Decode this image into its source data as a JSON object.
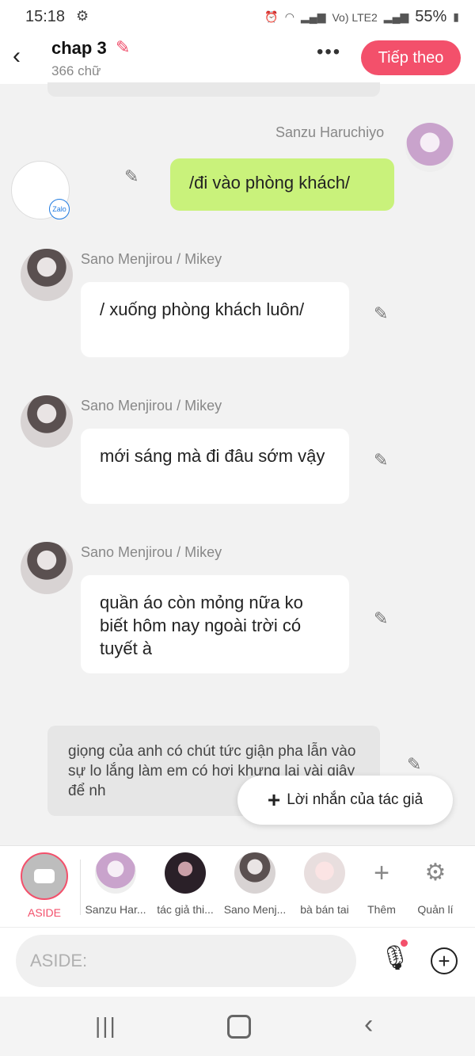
{
  "status": {
    "time": "15:18",
    "network": "Vo) LTE2",
    "battery": "55%"
  },
  "header": {
    "title": "chap 3",
    "word_count": "366 chữ",
    "next_label": "Tiếp theo",
    "more_label": "•••"
  },
  "messages": [
    {
      "speaker": "Sanzu Haruchiyo",
      "text": "/đi vào phòng khách/",
      "side": "right"
    },
    {
      "speaker": "Sano Menjirou / Mikey",
      "text": "/ xuống phòng khách luôn/",
      "side": "left"
    },
    {
      "speaker": "Sano Menjirou / Mikey",
      "text": "mới sáng mà đi đâu sớm vậy",
      "side": "left"
    },
    {
      "speaker": "Sano Menjirou / Mikey",
      "text": "quần áo còn mỏng nữa ko biết hôm nay ngoài trời có tuyết à",
      "side": "left"
    }
  ],
  "aside_text": "giọng của anh có chút tức giận pha lẫn vào sự lo lắng làm em có hơi khựng lại vài giây để nh",
  "float_button": {
    "label": "Lời nhắn của tác giả"
  },
  "zalo_badge": "Zalo",
  "characters": [
    {
      "label": "ASIDE",
      "type": "aside"
    },
    {
      "label": "Sanzu Har...",
      "type": "avatar"
    },
    {
      "label": "tác giả thi...",
      "type": "avatar"
    },
    {
      "label": "Sano Menj...",
      "type": "avatar"
    },
    {
      "label": "bà bán tai",
      "type": "avatar"
    }
  ],
  "tools": {
    "add_label": "Thêm",
    "manage_label": "Quản lí"
  },
  "input": {
    "placeholder": "ASIDE:"
  },
  "colors": {
    "accent": "#f3506b",
    "right_bubble": "#c9f27b"
  }
}
